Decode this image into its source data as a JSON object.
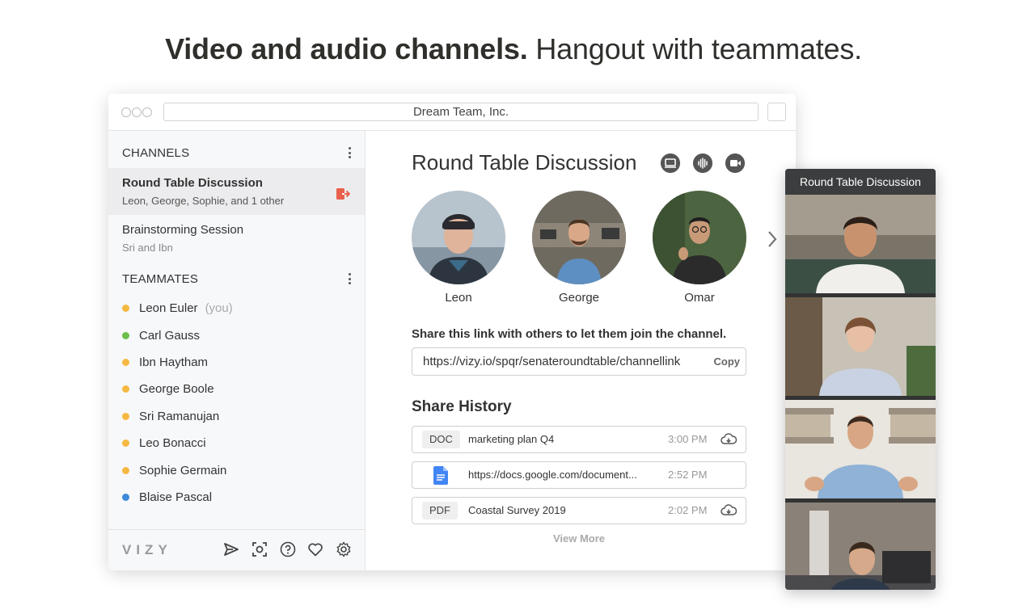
{
  "headline": {
    "bold": "Video and audio channels.",
    "rest": " Hangout with teammates."
  },
  "window": {
    "title": "Dream Team, Inc."
  },
  "sidebar": {
    "channels_title": "CHANNELS",
    "channels": [
      {
        "name": "Round Table Discussion",
        "members": "Leon, George, Sophie, and 1 other"
      },
      {
        "name": "Brainstorming Session",
        "members": "Sri and Ibn"
      }
    ],
    "teammates_title": "TEAMMATES",
    "teammates": [
      {
        "name": "Leon Euler",
        "note": "(you)",
        "status_color": "#f5b942"
      },
      {
        "name": "Carl Gauss",
        "note": "",
        "status_color": "#6cc04a"
      },
      {
        "name": "Ibn Haytham",
        "note": "",
        "status_color": "#f5b942"
      },
      {
        "name": "George Boole",
        "note": "",
        "status_color": "#f5b942"
      },
      {
        "name": "Sri Ramanujan",
        "note": "",
        "status_color": "#f5b942"
      },
      {
        "name": "Leo Bonacci",
        "note": "",
        "status_color": "#f5b942"
      },
      {
        "name": "Sophie Germain",
        "note": "",
        "status_color": "#f5b942"
      },
      {
        "name": "Blaise Pascal",
        "note": "",
        "status_color": "#3d8bd9"
      }
    ],
    "logo": "VIZY",
    "footer_icons": [
      "send-icon",
      "screenshot-icon",
      "help-icon",
      "heart-icon",
      "gear-icon"
    ]
  },
  "main": {
    "title": "Round Table Discussion",
    "header_icons": [
      "screen-share-icon",
      "audio-icon",
      "video-camera-icon"
    ],
    "participants": [
      {
        "name": "Leon"
      },
      {
        "name": "George"
      },
      {
        "name": "Omar"
      }
    ],
    "share_label": "Share this link with others to let them join the channel.",
    "share_link": "https://vizy.io/spqr/senateroundtable/channellink",
    "copy_label": "Copy",
    "history_title": "Share History",
    "history": [
      {
        "type": "DOC",
        "name": "marketing plan Q4",
        "time": "3:00 PM"
      },
      {
        "type": "google-doc-icon",
        "name": "https://docs.google.com/document...",
        "time": "2:52 PM"
      },
      {
        "type": "PDF",
        "name": "Coastal Survey 2019",
        "time": "2:02 PM"
      }
    ],
    "view_more": "View More"
  },
  "video_panel": {
    "title": "Round Table Discussion"
  },
  "colors": {
    "accent_red": "#e8604c",
    "status_away": "#f5b942",
    "status_online": "#6cc04a",
    "status_blue": "#3d8bd9"
  }
}
